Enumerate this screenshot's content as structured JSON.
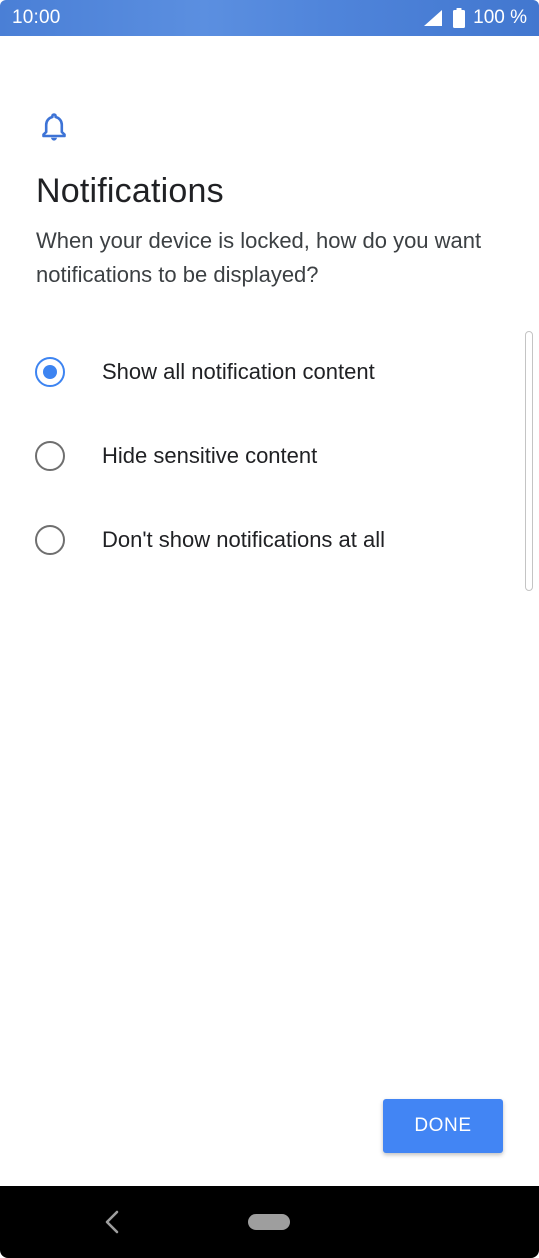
{
  "status_bar": {
    "time": "10:00",
    "battery": "100 %",
    "icons": [
      "signal-icon",
      "battery-icon"
    ]
  },
  "header": {
    "icon": "bell-icon",
    "title": "Notifications",
    "description": "When your device is locked, how do you want notifications to be displayed?"
  },
  "options": [
    {
      "label": "Show all notification content",
      "selected": true
    },
    {
      "label": "Hide sensitive content",
      "selected": false
    },
    {
      "label": "Don't show notifications at all",
      "selected": false
    }
  ],
  "footer": {
    "done_label": "DONE"
  },
  "navigation": {
    "icons": [
      "back-icon",
      "home-pill"
    ]
  },
  "colors": {
    "status_bar": "#4a7fd6",
    "accent": "#4285f4",
    "radio_checked": "#3d84f1",
    "radio_unchecked": "#6f6f6f",
    "nav_bar": "#000000"
  }
}
